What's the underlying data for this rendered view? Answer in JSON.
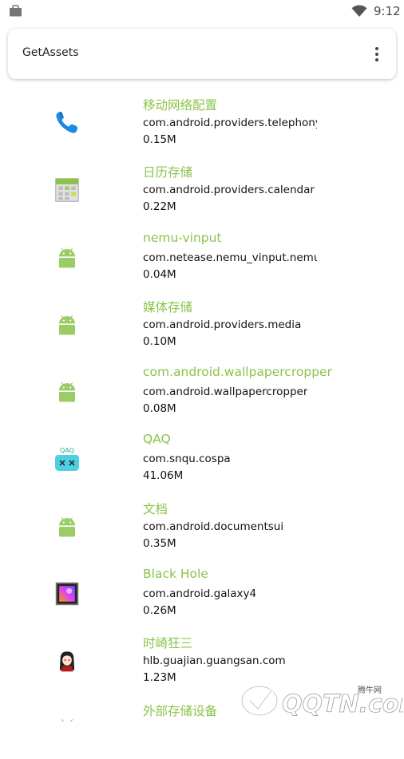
{
  "status_bar": {
    "time": "9:12"
  },
  "toolbar": {
    "title": "GetAssets"
  },
  "apps": [
    {
      "name": "移动网络配置",
      "package": "com.android.providers.telephony",
      "size": "0.15M",
      "icon": "phone-icon"
    },
    {
      "name": "日历存储",
      "package": "com.android.providers.calendar",
      "size": "0.22M",
      "icon": "calendar-icon"
    },
    {
      "name": "nemu-vinput",
      "package": "com.netease.nemu_vinput.nemu",
      "size": "0.04M",
      "icon": "android-icon"
    },
    {
      "name": "媒体存储",
      "package": "com.android.providers.media",
      "size": "0.10M",
      "icon": "android-icon"
    },
    {
      "name": "com.android.wallpapercropper",
      "package": "com.android.wallpapercropper",
      "size": "0.08M",
      "icon": "android-icon"
    },
    {
      "name": "QAQ",
      "package": "com.snqu.cospa",
      "size": "41.06M",
      "icon": "cospa-icon"
    },
    {
      "name": "文档",
      "package": "com.android.documentsui",
      "size": "0.35M",
      "icon": "android-icon"
    },
    {
      "name": "Black Hole",
      "package": "com.android.galaxy4",
      "size": "0.26M",
      "icon": "black-hole-icon"
    },
    {
      "name": "时崎狂三",
      "package": "hlb.guajian.guangsan.com",
      "size": "1.23M",
      "icon": "anime-avatar-icon"
    },
    {
      "name": "外部存储设备",
      "package": "",
      "size": "",
      "icon": "android-icon"
    }
  ],
  "watermark": {
    "text": "QQTN.com",
    "small_text": "腾牛网"
  },
  "colors": {
    "accent": "#8bc34a",
    "android_green": "#9ccc65"
  }
}
